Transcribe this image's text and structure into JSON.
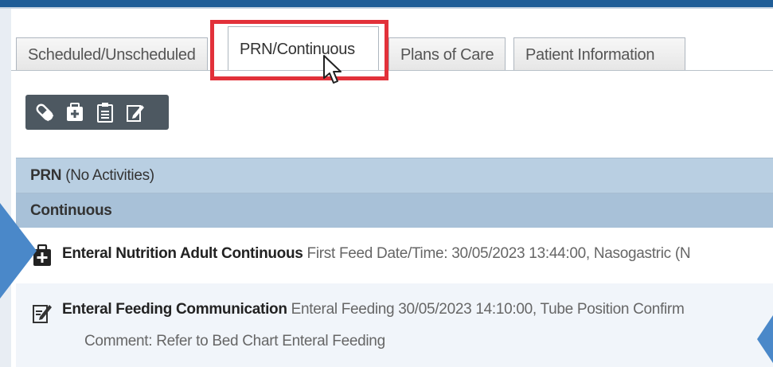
{
  "tabs": [
    {
      "label": "Scheduled/Unscheduled",
      "active": false
    },
    {
      "label": "PRN/Continuous",
      "active": true
    },
    {
      "label": "Plans of Care",
      "active": false
    },
    {
      "label": "Patient Information",
      "active": false
    }
  ],
  "toolbar": {
    "icons": [
      "pill-icon",
      "medical-bag-icon",
      "clipboard-icon",
      "edit-document-icon"
    ]
  },
  "sections": {
    "prn": {
      "title": "PRN",
      "note": "(No Activities)"
    },
    "continuous": {
      "title": "Continuous"
    }
  },
  "rows": [
    {
      "icon": "medical-bag-icon",
      "title": "Enteral Nutrition Adult Continuous",
      "detail": "First Feed Date/Time: 30/05/2023 13:44:00, Nasogastric (N"
    },
    {
      "icon": "edit-document-icon",
      "title": "Enteral Feeding Communication",
      "detail": "Enteral Feeding 30/05/2023 14:10:00, Tube Position Confirm",
      "comment": "Comment: Refer to Bed Chart Enteral Feeding"
    }
  ],
  "colors": {
    "highlight": "#e2313a",
    "header_bar": "#1f5d97",
    "section_bg": "#b9cfe2",
    "callout_arrow": "#4a88c9"
  }
}
